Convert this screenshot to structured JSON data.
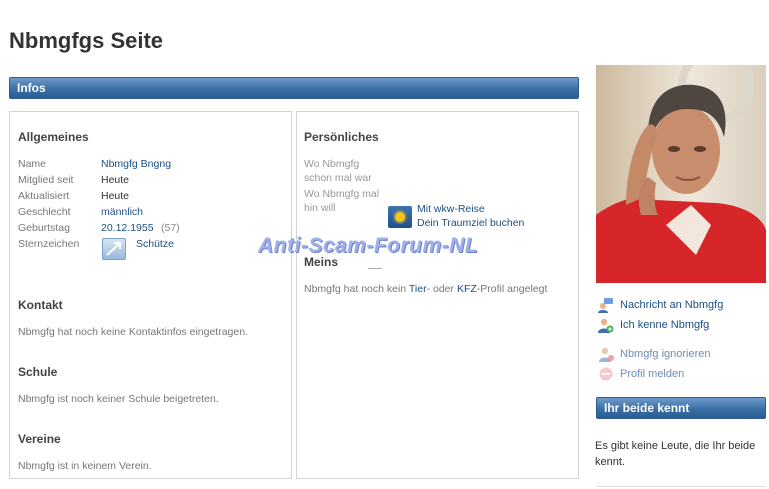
{
  "page": {
    "title": "Nbmgfgs Seite"
  },
  "infos_bar": {
    "label": "Infos"
  },
  "allgemeines": {
    "heading": "Allgemeines",
    "rows": [
      {
        "label": "Name",
        "value": "Nbmgfg Bngng"
      },
      {
        "label": "Mitglied seit",
        "value": "Heute"
      },
      {
        "label": "Aktualisiert",
        "value": "Heute"
      },
      {
        "label": "Geschlecht",
        "value": "männlich"
      },
      {
        "label": "Geburtstag",
        "value": "20.12.1955",
        "extra": "(57)"
      },
      {
        "label": "Sternzeichen",
        "value": "Schütze"
      }
    ]
  },
  "kontakt": {
    "heading": "Kontakt",
    "text": "Nbmgfg hat noch keine Kontaktinfos eingetragen."
  },
  "schule": {
    "heading": "Schule",
    "text": "Nbmgfg ist noch keiner Schule beigetreten."
  },
  "vereine": {
    "heading": "Vereine",
    "text": "Nbmgfg ist in keinem Verein."
  },
  "persoenliches": {
    "heading": "Persönliches",
    "line1": "Wo Nbmgfg",
    "line2": "schon mal war",
    "line3": "Wo Nbmgfg mal",
    "line4": "hin will",
    "ad_line1": "Mit wkw-Reise",
    "ad_line2": "Dein Traumziel buchen"
  },
  "meins": {
    "heading": "Meins",
    "text_prefix": "Nbmgfg hat noch kein ",
    "tier_link": "Tier",
    "text_middle": "- oder ",
    "kfz_link": "KFZ",
    "text_suffix": "-Profil angelegt"
  },
  "watermark": {
    "text": "Anti-Scam-Forum-NL"
  },
  "actions": {
    "nachricht": "Nachricht an Nbmgfg",
    "kenne": "Ich kenne Nbmgfg",
    "ignorieren": "Nbmgfg ignorieren",
    "melden": "Profil melden"
  },
  "beide_kennt": {
    "heading": "Ihr beide kennt",
    "text": "Es gibt keine Leute, die Ihr beide kennt."
  },
  "colors": {
    "bar_blue": "#3a6fa6",
    "link_blue": "#1d4f85",
    "photo_shirt_red": "#d7262a"
  },
  "icons": {
    "zodiac": "sagittarius-icon",
    "ad": "sun-icon",
    "message": "message-user-icon",
    "know": "know-user-icon",
    "ignore": "ignore-user-icon",
    "report": "report-icon"
  }
}
